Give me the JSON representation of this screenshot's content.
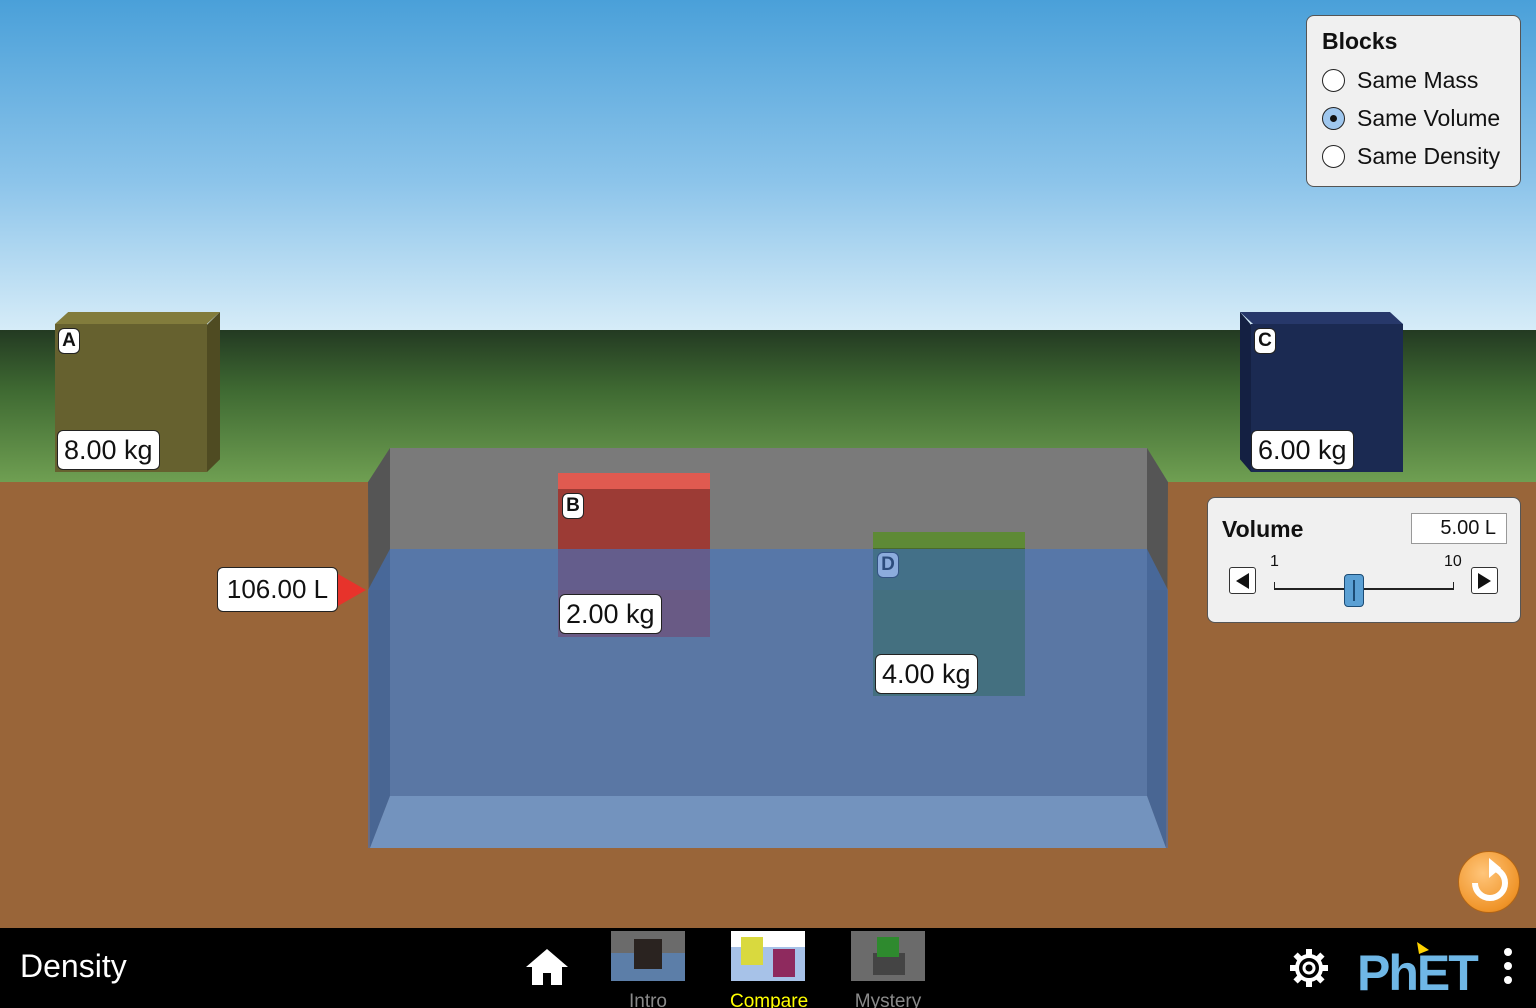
{
  "sim": {
    "title": "Density"
  },
  "blocks_panel": {
    "title": "Blocks",
    "options": [
      {
        "label": "Same Mass",
        "selected": false
      },
      {
        "label": "Same Volume",
        "selected": true
      },
      {
        "label": "Same Density",
        "selected": false
      }
    ]
  },
  "volume_panel": {
    "title": "Volume",
    "value": "5.00 L",
    "min_label": "1",
    "max_label": "10",
    "slider_value": 5
  },
  "pool": {
    "volume_readout": "106.00 L"
  },
  "blocks": {
    "a": {
      "letter": "A",
      "mass": "8.00 kg",
      "color": "#66612f"
    },
    "b": {
      "letter": "B",
      "mass": "2.00 kg",
      "color": "#9c3b35"
    },
    "c": {
      "letter": "C",
      "mass": "6.00 kg",
      "color": "#1b2a52"
    },
    "d": {
      "letter": "D",
      "mass": "4.00 kg",
      "color": "#4a6a2c"
    }
  },
  "navbar": {
    "tabs": [
      {
        "label": "Intro",
        "active": false
      },
      {
        "label": "Compare",
        "active": true
      },
      {
        "label": "Mystery",
        "active": false
      }
    ],
    "active_color": "#ffff00",
    "inactive_color": "#8a8a8a",
    "logo_text": "PhET"
  }
}
